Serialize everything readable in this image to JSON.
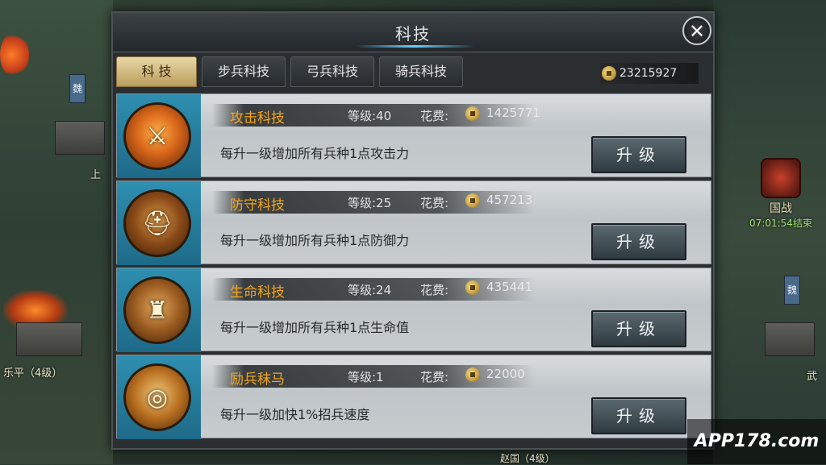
{
  "background": {
    "labels": [
      "上",
      "乐平（4级）",
      "武",
      "赵国（4级）"
    ],
    "flag_char": "魏",
    "guozhan": {
      "label": "国战",
      "timer": "07:01:54结束"
    }
  },
  "panel": {
    "title": "科技",
    "close_symbol": "✕",
    "tabs": [
      {
        "label": "科 技",
        "active": true
      },
      {
        "label": "步兵科技",
        "active": false
      },
      {
        "label": "弓兵科技",
        "active": false
      },
      {
        "label": "骑兵科技",
        "active": false
      }
    ],
    "gold_total": "23215927"
  },
  "techs": [
    {
      "name": "攻击科技",
      "level": "等级:40",
      "cost_label": "花费:",
      "cost": "1425771",
      "desc": "每升一级增加所有兵种1点攻击力",
      "button": "升级",
      "icon": "axe-icon"
    },
    {
      "name": "防守科技",
      "level": "等级:25",
      "cost_label": "花费:",
      "cost": "457213",
      "desc": "每升一级增加所有兵种1点防御力",
      "button": "升级",
      "icon": "helmet-icon"
    },
    {
      "name": "生命科技",
      "level": "等级:24",
      "cost_label": "花费:",
      "cost": "435441",
      "desc": "每升一级增加所有兵种1点生命值",
      "button": "升级",
      "icon": "armor-icon"
    },
    {
      "name": "励兵秣马",
      "level": "等级:1",
      "cost_label": "花费:",
      "cost": "22000",
      "desc": "每升一级加快1%招兵速度",
      "button": "升级",
      "icon": "bracer-icon"
    }
  ],
  "watermark": "APP178.com"
}
